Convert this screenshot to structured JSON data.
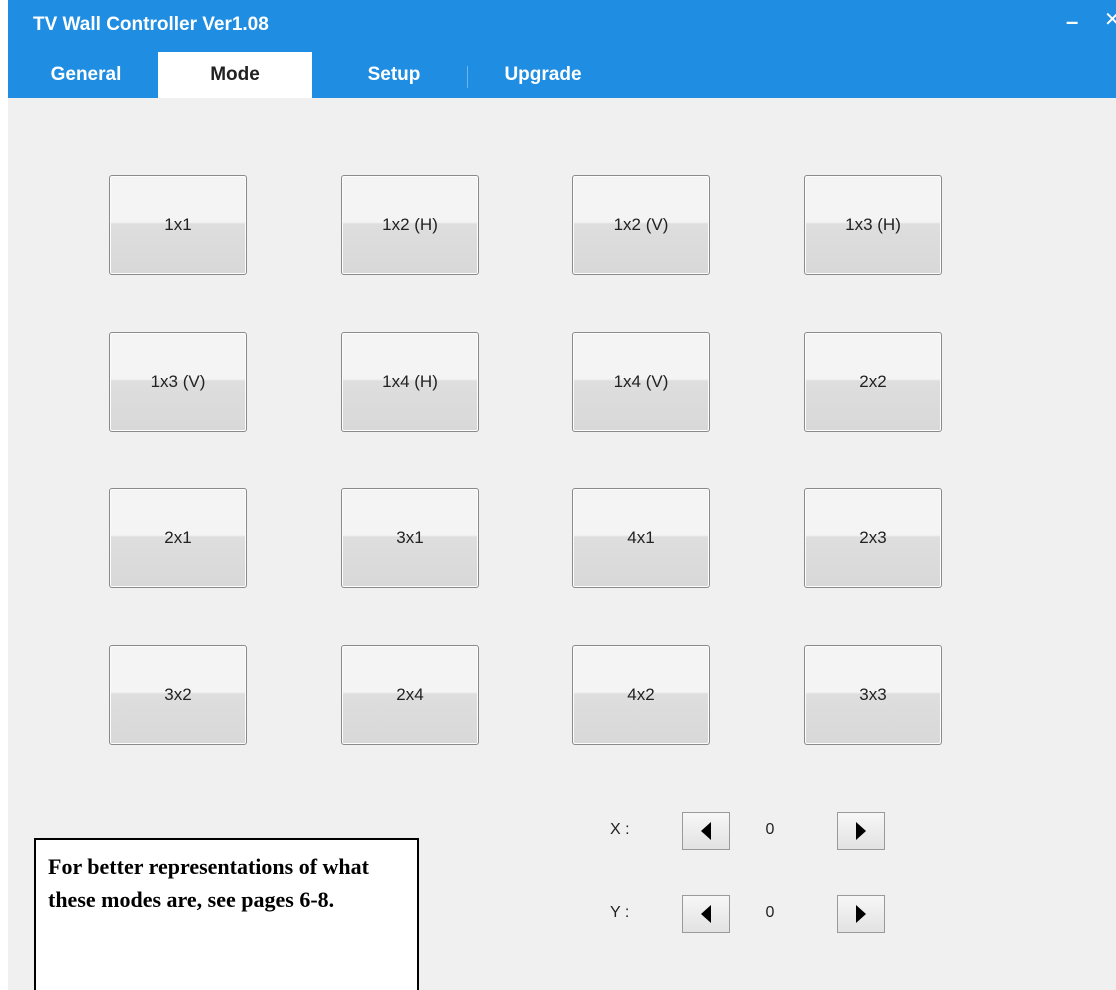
{
  "window": {
    "title": "TV Wall Controller Ver1.08",
    "minimize_glyph": "–",
    "close_glyph": "✕"
  },
  "tabs": [
    {
      "label": "General",
      "active": false
    },
    {
      "label": "Mode",
      "active": true
    },
    {
      "label": "Setup",
      "active": false
    },
    {
      "label": "Upgrade",
      "active": false
    }
  ],
  "modes": [
    "1x1",
    "1x2 (H)",
    "1x2 (V)",
    "1x3 (H)",
    "1x3 (V)",
    "1x4 (H)",
    "1x4 (V)",
    "2x2",
    "2x1",
    "3x1",
    "4x1",
    "2x3",
    "3x2",
    "2x4",
    "4x2",
    "3x3"
  ],
  "position": {
    "x": {
      "label": "X :",
      "value": "0"
    },
    "y": {
      "label": "Y :",
      "value": "0"
    }
  },
  "note": {
    "text": "For better representations of what these modes are, see pages 6-8."
  },
  "colors": {
    "header": "#1f8ee2",
    "background": "#f0f0f0"
  }
}
